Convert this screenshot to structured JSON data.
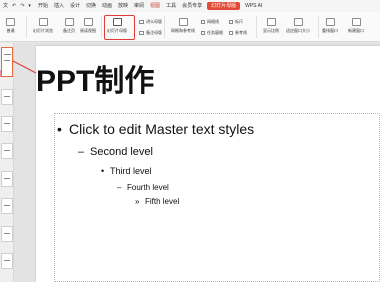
{
  "quick_access": [
    "文",
    "↶",
    "↷",
    "▾"
  ],
  "menu": [
    {
      "label": "开始"
    },
    {
      "label": "插入"
    },
    {
      "label": "设计"
    },
    {
      "label": "切换"
    },
    {
      "label": "动画"
    },
    {
      "label": "放映"
    },
    {
      "label": "审阅"
    },
    {
      "label": "视图",
      "active": true
    },
    {
      "label": "工具"
    },
    {
      "label": "会员专享"
    }
  ],
  "context_tab": "幻灯片母版",
  "wps_ai": "WPS AI",
  "ribbon": {
    "normal": "普通",
    "slide_browse": "幻灯片浏览",
    "notes_page": "备注页",
    "reading_view": "阅读视图",
    "slide_master": "幻灯片母版",
    "handout_master": "讲义母版",
    "notes_master": "备注母版",
    "grid_guides": "网格和参考线",
    "show_gridlines": "网格线",
    "ruler": "标尺",
    "task_pane": "任务窗格",
    "guides": "参考线",
    "display_ratio": "显示比例",
    "fit_window": "适应窗口大小",
    "rearrange": "重排窗口",
    "new_window": "新建窗口"
  },
  "slide": {
    "title": "PPT制作",
    "levels": [
      {
        "bullet": "•",
        "text": "Click to edit Master text styles"
      },
      {
        "bullet": "–",
        "text": "Second level"
      },
      {
        "bullet": "•",
        "text": "Third level"
      },
      {
        "bullet": "–",
        "text": "Fourth level"
      },
      {
        "bullet": "»",
        "text": "Fifth level"
      }
    ]
  },
  "colors": {
    "accent_red": "#e03a3a",
    "context_tab_bg": "#e14a36"
  }
}
